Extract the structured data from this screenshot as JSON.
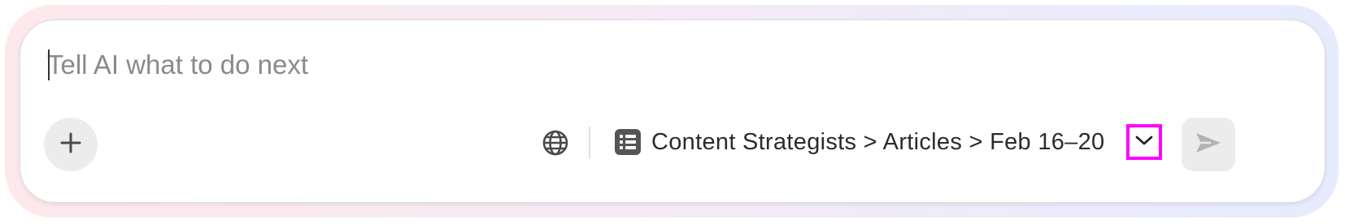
{
  "composer": {
    "placeholder": "Tell AI what to do next",
    "value": ""
  },
  "toolbar": {
    "add_icon": "plus-icon",
    "web_search_icon": "globe-icon",
    "context": {
      "icon": "table-list-icon",
      "path": "Content Strategists > Articles > Feb 16–20",
      "dropdown_icon": "chevron-down-icon"
    },
    "send_icon": "send-icon"
  },
  "colors": {
    "highlight_border": "#ff00ff",
    "button_bg": "#ececec",
    "placeholder_text": "#8a8a8a"
  }
}
